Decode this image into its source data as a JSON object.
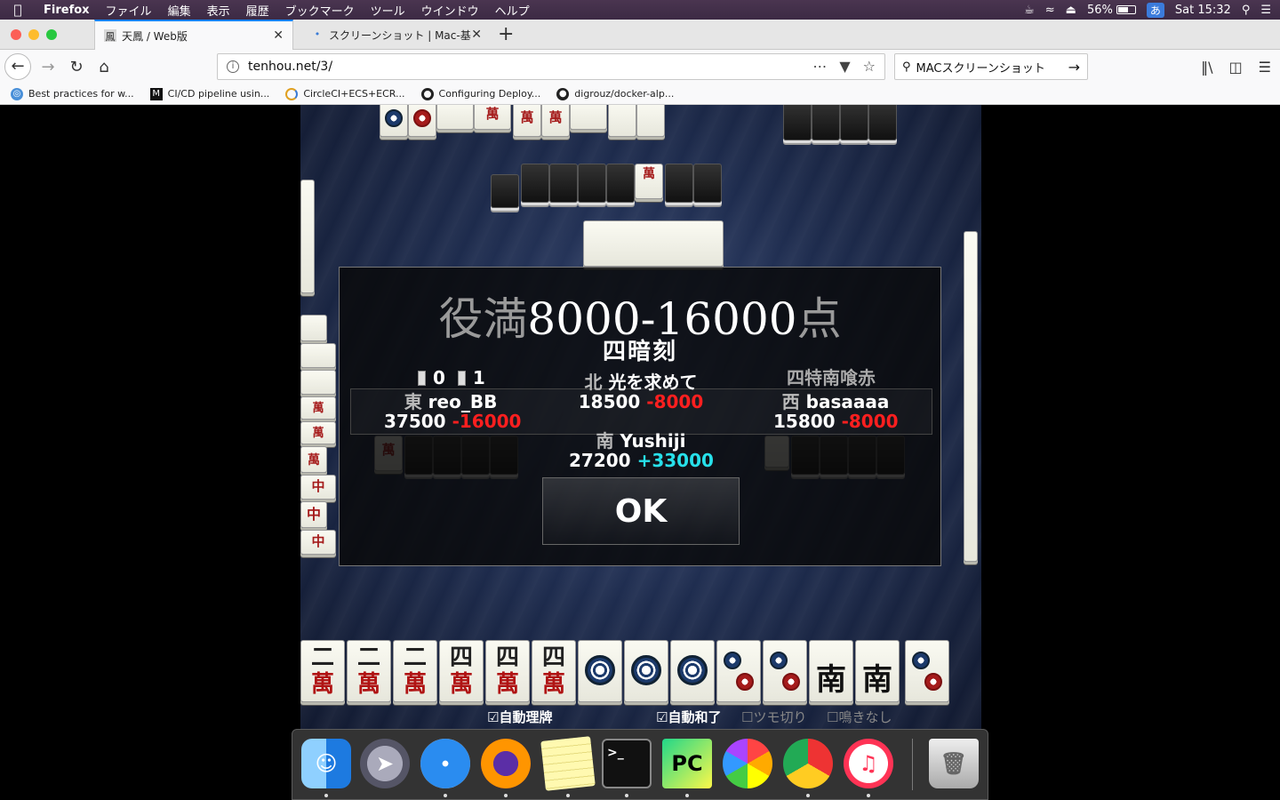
{
  "menubar": {
    "app": "Firefox",
    "items": [
      "ファイル",
      "編集",
      "表示",
      "履歴",
      "ブックマーク",
      "ツール",
      "ウインドウ",
      "ヘルプ"
    ],
    "battery": "56%",
    "ime": "あ",
    "clock": "Sat 15:32"
  },
  "tabs": [
    {
      "title": "天鳳 / Web版",
      "favicon": "tenhou-icon"
    },
    {
      "title": "スクリーンショット | Mac-基本 |",
      "favicon": "dot-icon"
    }
  ],
  "url": "tenhou.net/3/",
  "search": {
    "value": "MACスクリーンショット"
  },
  "bookmarks": [
    {
      "label": "Best practices for w...",
      "icon": "globe-icon"
    },
    {
      "label": "CI/CD pipeline usin...",
      "icon": "medium-icon"
    },
    {
      "label": "CircleCI+ECS+ECR...",
      "icon": "circle-icon"
    },
    {
      "label": "Configuring Deploy...",
      "icon": "circleci-icon"
    },
    {
      "label": "digrouz/docker-alp...",
      "icon": "github-icon"
    }
  ],
  "result": {
    "title_prefix": "役満",
    "title_points": "8000-16000",
    "title_suffix": "点",
    "yaku": "四暗刻",
    "honba": "0",
    "riichi_sticks": "1",
    "other_yaku": "四特南喰赤",
    "players": {
      "east": {
        "wind": "東",
        "name": "reo_BB",
        "score": "37500",
        "delta": "-16000"
      },
      "north": {
        "wind": "北",
        "name": "光を求めて",
        "score": "18500",
        "delta": "-8000"
      },
      "west": {
        "wind": "西",
        "name": "basaaaa",
        "score": "15800",
        "delta": "-8000"
      },
      "south": {
        "wind": "南",
        "name": "Yushiji",
        "score": "27200",
        "delta": "+33000"
      }
    },
    "ok_label": "OK"
  },
  "options": {
    "auto_sort": "☑自動理牌",
    "auto_win": "☑自動和了",
    "tsumogiri": "☐ツモ切り",
    "no_call": "☐鳴きなし"
  },
  "hand": {
    "tiles": [
      "二萬",
      "二萬",
      "二萬",
      "四萬",
      "四萬",
      "四萬",
      "1p",
      "1p",
      "1p",
      "2p",
      "2p",
      "南",
      "南",
      "2p"
    ]
  },
  "dock": [
    "Finder",
    "Launchpad",
    "Safari",
    "Firefox",
    "Notes",
    "Terminal",
    "PyCharm",
    "Photos",
    "Chrome",
    "iTunes",
    "Trash"
  ]
}
